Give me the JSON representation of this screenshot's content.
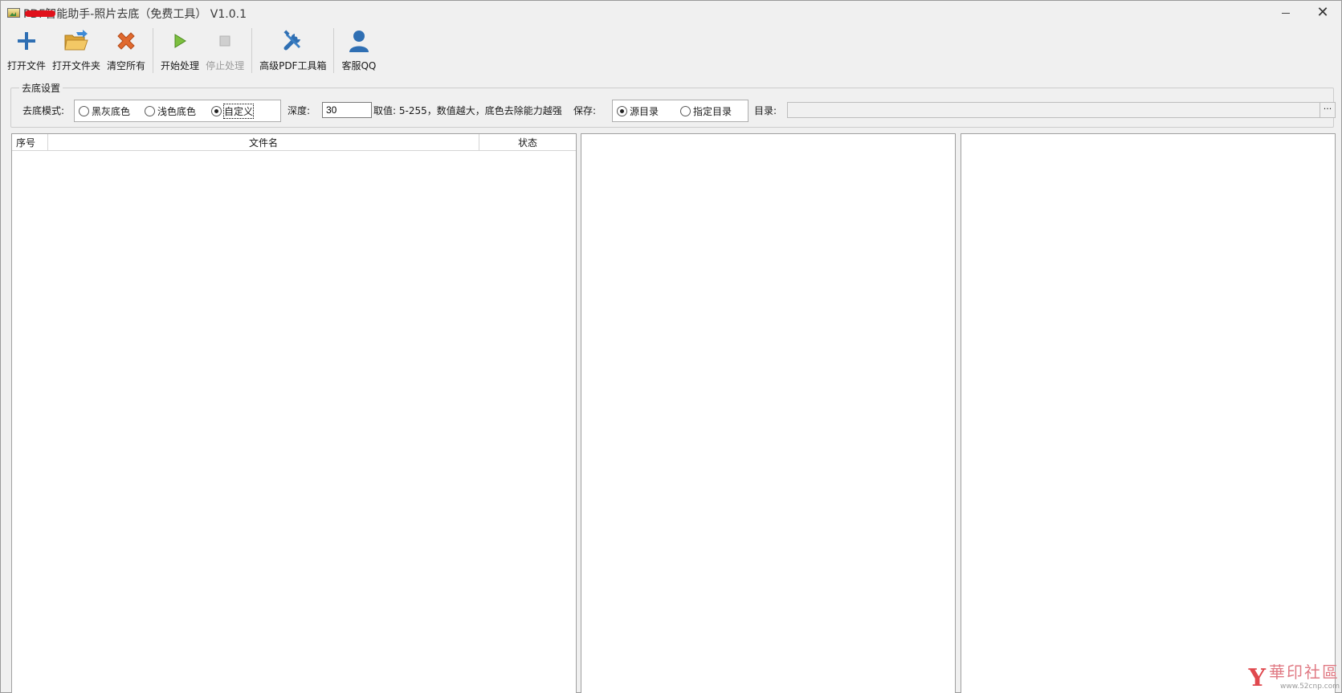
{
  "window": {
    "title": "PDF智能助手-照片去底（免费工具） V1.0.1",
    "minimize": "—",
    "close": "✕"
  },
  "toolbar": {
    "open_file": "打开文件",
    "open_folder": "打开文件夹",
    "clear_all": "清空所有",
    "start": "开始处理",
    "stop": "停止处理",
    "pdf_tools": "高级PDF工具箱",
    "support": "客服QQ"
  },
  "settings": {
    "group_title": "去底设置",
    "mode_label": "去底模式:",
    "modes": [
      "黑灰底色",
      "浅色底色",
      "自定义"
    ],
    "selected_mode": "自定义",
    "depth_label": "深度:",
    "depth_value": "30",
    "depth_hint": "取值: 5-255，数值越大，底色去除能力越强",
    "save_label": "保存:",
    "save_options": [
      "源目录",
      "指定目录"
    ],
    "selected_save": "源目录",
    "dir_label": "目录:",
    "dir_value": "",
    "browse": "···"
  },
  "list": {
    "columns": [
      "序号",
      "文件名",
      "状态"
    ],
    "rows": []
  },
  "watermark": {
    "logo": "Y",
    "text": "華印社區",
    "url": "www.52cnp.com"
  },
  "colors": {
    "accent_blue": "#2f6fb3",
    "clear_orange": "#e0692e",
    "play_green": "#5aa02c",
    "folder_yellow": "#e8b64c"
  }
}
